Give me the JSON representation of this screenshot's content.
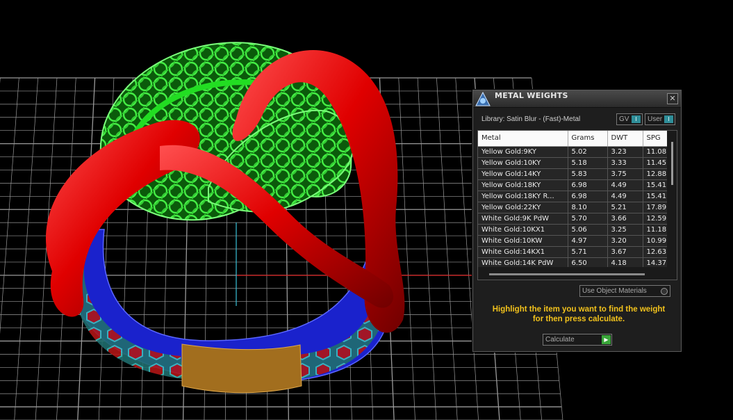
{
  "viewport": {
    "colors": {
      "background": "#000000",
      "grid": "#9a9a9a",
      "ring_red": "#e60000",
      "ring_green": "#22dd22",
      "band_blue": "#1a22cc",
      "band_gold": "#b07a20",
      "axis_red": "#d81e1e",
      "axis_cyan": "#39c0d8"
    }
  },
  "panel": {
    "title": "METAL WEIGHTS",
    "close_symbol": "✕",
    "library": "Library: Satin Blur - (Fast)-Metal",
    "toggles": [
      {
        "label": "GV",
        "knob": "I"
      },
      {
        "label": "User",
        "knob": "I"
      }
    ],
    "table": {
      "headers": [
        "Metal",
        "Grams",
        "DWT",
        "SPG"
      ],
      "rows": [
        [
          "Yellow Gold:9KY",
          "5.02",
          "3.23",
          "11.08"
        ],
        [
          "Yellow Gold:10KY",
          "5.18",
          "3.33",
          "11.45"
        ],
        [
          "Yellow Gold:14KY",
          "5.83",
          "3.75",
          "12.88"
        ],
        [
          "Yellow Gold:18KY",
          "6.98",
          "4.49",
          "15.41"
        ],
        [
          "Yellow Gold:18KY R...",
          "6.98",
          "4.49",
          "15.41"
        ],
        [
          "Yellow Gold:22KY",
          "8.10",
          "5.21",
          "17.89"
        ],
        [
          "White Gold:9K PdW",
          "5.70",
          "3.66",
          "12.59"
        ],
        [
          "White Gold:10KX1",
          "5.06",
          "3.25",
          "11.18"
        ],
        [
          "White Gold:10KW",
          "4.97",
          "3.20",
          "10.99"
        ],
        [
          "White Gold:14KX1",
          "5.71",
          "3.67",
          "12.63"
        ],
        [
          "White Gold:14K PdW",
          "6.50",
          "4.18",
          "14.37"
        ]
      ]
    },
    "use_object_materials": "Use Object Materials",
    "hint_line1": "Highlight the item you want to find the weight",
    "hint_line2": "for then press calculate.",
    "calculate_label": "Calculate",
    "calculate_icon": "▶"
  }
}
